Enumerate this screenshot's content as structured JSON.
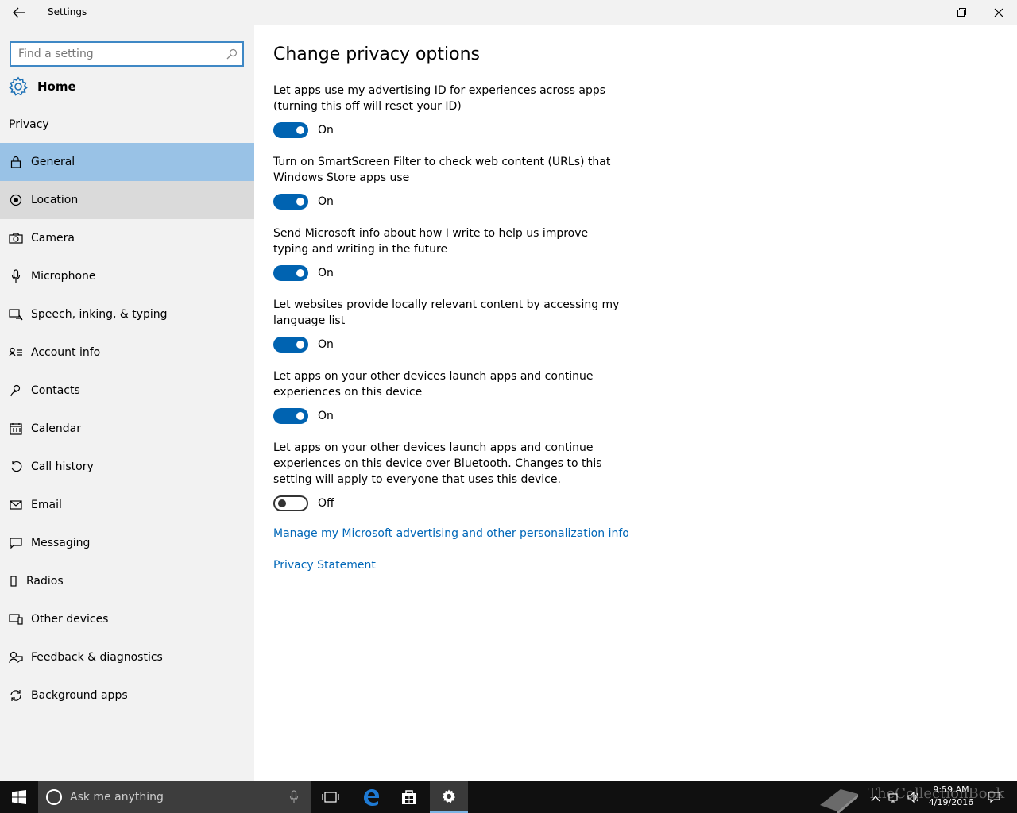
{
  "window": {
    "title": "Settings"
  },
  "sidebar": {
    "search_placeholder": "Find a setting",
    "home_label": "Home",
    "section_label": "Privacy",
    "items": [
      {
        "label": "General",
        "icon": "lock-icon",
        "state": "selected"
      },
      {
        "label": "Location",
        "icon": "location-icon",
        "state": "hover"
      },
      {
        "label": "Camera",
        "icon": "camera-icon"
      },
      {
        "label": "Microphone",
        "icon": "microphone-icon"
      },
      {
        "label": "Speech, inking, & typing",
        "icon": "speech-icon"
      },
      {
        "label": "Account info",
        "icon": "account-info-icon"
      },
      {
        "label": "Contacts",
        "icon": "contacts-icon"
      },
      {
        "label": "Calendar",
        "icon": "calendar-icon"
      },
      {
        "label": "Call history",
        "icon": "call-history-icon"
      },
      {
        "label": "Email",
        "icon": "email-icon"
      },
      {
        "label": "Messaging",
        "icon": "messaging-icon"
      },
      {
        "label": "Radios",
        "icon": "radios-icon"
      },
      {
        "label": "Other devices",
        "icon": "other-devices-icon"
      },
      {
        "label": "Feedback & diagnostics",
        "icon": "feedback-icon"
      },
      {
        "label": "Background apps",
        "icon": "background-apps-icon"
      }
    ]
  },
  "main": {
    "title": "Change privacy options",
    "settings": [
      {
        "description": "Let apps use my advertising ID for experiences across apps (turning this off will reset your ID)",
        "state": "On",
        "on": true
      },
      {
        "description": "Turn on SmartScreen Filter to check web content (URLs) that Windows Store apps use",
        "state": "On",
        "on": true
      },
      {
        "description": "Send Microsoft info about how I write to help us improve typing and writing in the future",
        "state": "On",
        "on": true
      },
      {
        "description": "Let websites provide locally relevant content by accessing my language list",
        "state": "On",
        "on": true
      },
      {
        "description": "Let apps on your other devices launch apps and continue experiences on this device",
        "state": "On",
        "on": true
      },
      {
        "description": "Let apps on your other devices launch apps and continue experiences on this device over Bluetooth. Changes to this setting will apply to everyone that uses this device.",
        "state": "Off",
        "on": false
      }
    ],
    "links": {
      "manage": "Manage my Microsoft advertising and other personalization info",
      "privacy_statement": "Privacy Statement"
    }
  },
  "taskbar": {
    "search_placeholder": "Ask me anything",
    "time": "9:59 AM",
    "date": "4/19/2016",
    "watermark": "TheCollectionBook"
  },
  "colors": {
    "accent": "#0063b1",
    "link": "#0067b8",
    "selected_nav": "#99c2e6",
    "sidebar_bg": "#f2f2f2",
    "taskbar_bg": "#101010"
  }
}
